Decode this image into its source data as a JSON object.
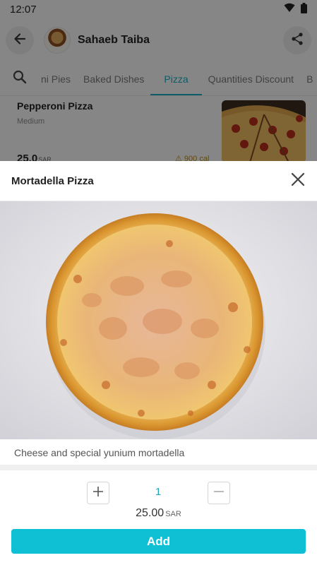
{
  "status_bar": {
    "time": "12:07",
    "icons": [
      "wifi-icon",
      "battery-icon"
    ]
  },
  "header": {
    "store_name": "Sahaeb Taiba",
    "back_icon": "arrow-left-icon",
    "share_icon": "share-icon"
  },
  "categories": {
    "search_icon": "search-icon",
    "tabs": [
      "ni Pies",
      "Baked Dishes",
      "Pizza",
      "Quantities Discount",
      "B"
    ],
    "active": "Pizza"
  },
  "background_product": {
    "name": "Pepperoni Pizza",
    "size": "Medium",
    "price": "25.0",
    "currency": "SAR",
    "calories": "900 cal"
  },
  "sheet": {
    "title": "Mortadella Pizza",
    "close_icon": "close-icon",
    "description": "Cheese and special yunium mortadella",
    "quantity": "1",
    "plus_label": "+",
    "minus_label": "−",
    "total_price": "25.00",
    "currency": "SAR",
    "add_label": "Add"
  },
  "colors": {
    "accent": "#1aa9bd",
    "add_button": "#0fc0d4",
    "calorie_warning": "#b8860b"
  }
}
